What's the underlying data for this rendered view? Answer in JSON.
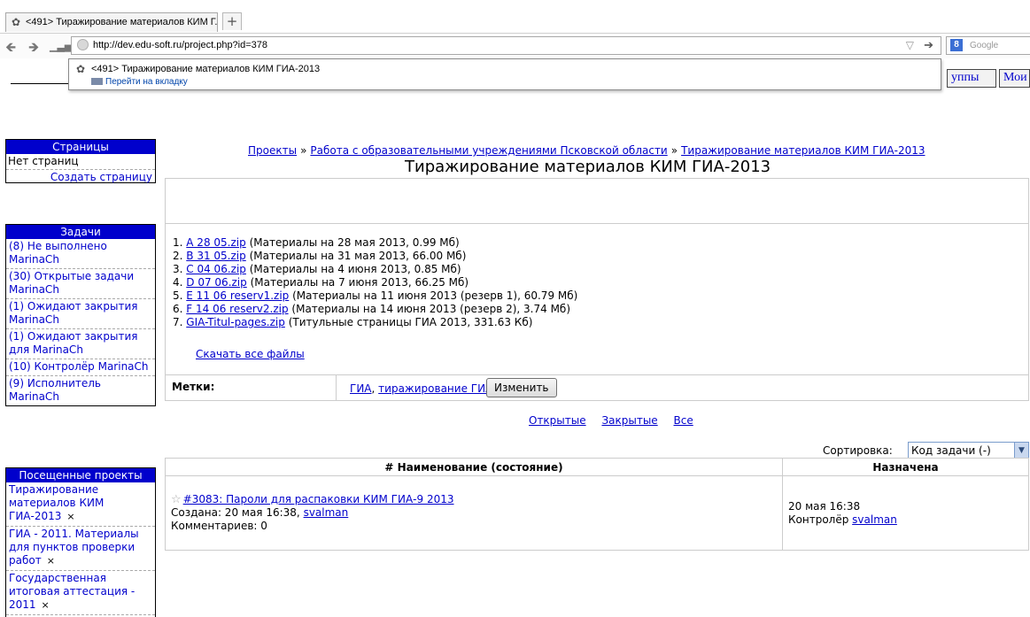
{
  "browser": {
    "tab_title": "<491> Тиражирование материалов КИМ Г...",
    "new_tab": "+",
    "url": "http://dev.edu-soft.ru/project.php?id=378",
    "search_placeholder": "Google",
    "search_engine_letter": "8",
    "suggestion": {
      "title": "<491> Тиражирование материалов КИМ ГИА-2013",
      "action": "Перейти на вкладку"
    }
  },
  "top_buttons": [
    "уппы",
    "Мои"
  ],
  "sidebar": {
    "pages": {
      "header": "Страницы",
      "empty": "Нет страниц",
      "create": "Создать страницу"
    },
    "tasks": {
      "header": "Задачи",
      "items": [
        "(8) Не выполнено MarinaCh",
        "(30) Открытые задачи MarinaCh",
        "(1) Ожидают закрытия MarinaCh",
        "(1) Ожидают закрытия для MarinaCh",
        "(10) Контролёр MarinaCh",
        "(9) Исполнитель MarinaCh"
      ]
    },
    "visited": {
      "header": "Посещенные проекты",
      "items": [
        "Тиражирование материалов КИМ ГИА-2013",
        "ГИА - 2011. Материалы для пунктов проверки работ",
        "Государственная итоговая аттестация - 2011"
      ],
      "remove": "×"
    }
  },
  "breadcrumb": {
    "items": [
      "Проекты",
      "Работа с образовательными учреждениями Псковской области",
      "Тиражирование материалов КИМ ГИА-2013"
    ],
    "sep": "»"
  },
  "page_title": "Тиражирование материалов КИМ ГИА-2013",
  "files": [
    {
      "num": "1.",
      "name": "A 28 05.zip",
      "desc": "(Материалы на 28 мая 2013, 0.99 Мб)"
    },
    {
      "num": "2.",
      "name": "B 31 05.zip",
      "desc": "(Материалы на 31 мая 2013, 66.00 Мб)"
    },
    {
      "num": "3.",
      "name": "C 04 06.zip",
      "desc": "(Материалы на 4 июня 2013, 0.85 Мб)"
    },
    {
      "num": "4.",
      "name": "D 07 06.zip",
      "desc": "(Материалы на 7 июня 2013, 66.25 Мб)"
    },
    {
      "num": "5.",
      "name": "E 11 06 reserv1.zip",
      "desc": "(Материалы на 11 июня 2013 (резерв 1), 60.79 Мб)"
    },
    {
      "num": "6.",
      "name": "F 14 06 reserv2.zip",
      "desc": "(Материалы на 14 июня 2013 (резерв 2), 3.74 Мб)"
    },
    {
      "num": "7.",
      "name": "GIA-Titul-pages.zip",
      "desc": "(Титульные страницы ГИА 2013, 331.63 Кб)"
    }
  ],
  "download_all": "Скачать все файлы",
  "tags": {
    "label": "Метки:",
    "items": [
      "ГИА",
      "тиражирование ГИА"
    ],
    "sep": ",",
    "edit_button": "Изменить"
  },
  "filters": [
    "Открытые",
    "Закрытые",
    "Все"
  ],
  "sort": {
    "label": "Сортировка:",
    "value": "Код задачи (-)"
  },
  "table": {
    "headers": [
      "# Наименование (состояние)",
      "Назначена"
    ],
    "rows": [
      {
        "title": "#3083: Пароли для распаковки КИМ ГИА-9 2013",
        "created_prefix": "Создана: 20 мая 16:38,",
        "created_by": "svalman",
        "comments": "Комментариев: 0",
        "assigned_date": "20 мая 16:38",
        "assigned_role": "Контролёр",
        "assigned_user": "svalman"
      }
    ]
  }
}
